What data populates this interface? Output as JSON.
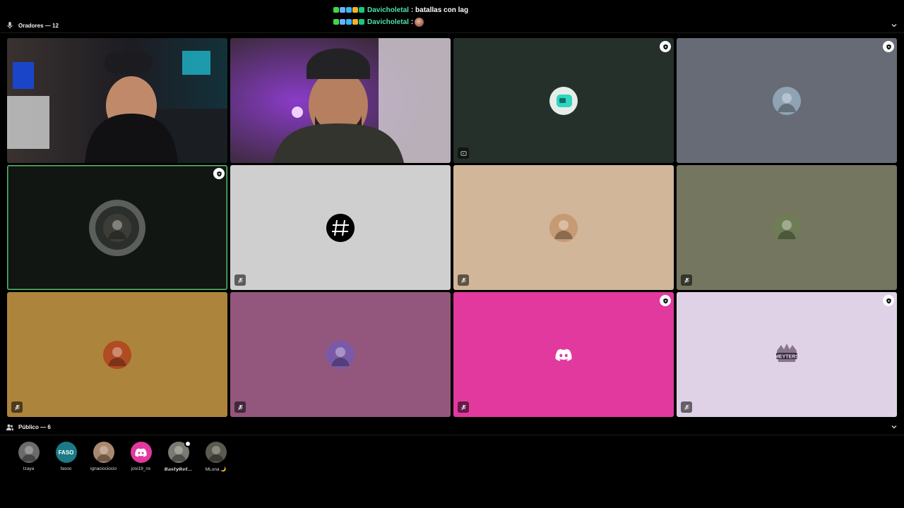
{
  "chat": {
    "messages": [
      {
        "user": "Davicholetal",
        "text": ": batallas con lag",
        "emote": false
      },
      {
        "user": "Davicholetal",
        "text": ":",
        "emote": true
      }
    ],
    "badge_colors": [
      "#3fd94a",
      "#6ab0ff",
      "#37b5ff",
      "#f3b12a",
      "#18c97a"
    ]
  },
  "speakers_section": {
    "label": "Oradores — 12"
  },
  "speakers": [
    {
      "kind": "camera",
      "name": "speaker-camera-1",
      "background": "#2a2520"
    },
    {
      "kind": "camera",
      "name": "speaker-camera-2",
      "background": "#3a2b3e"
    },
    {
      "kind": "avatar",
      "background": "#26302b",
      "avatar": "#2dd6c0",
      "icon": "stream-icon",
      "shield": true
    },
    {
      "kind": "avatar",
      "background": "#676b76",
      "avatar": "#8fa3b4",
      "icon": "",
      "shield": true
    },
    {
      "kind": "avatar",
      "background": "#121612",
      "avatar": "#3d3d38",
      "speaking": true,
      "shield": true
    },
    {
      "kind": "avatar",
      "background": "#cfcfcf",
      "avatar": "#000000",
      "icon": "hashtag-icon",
      "muted": true
    },
    {
      "kind": "avatar",
      "background": "#d1b699",
      "avatar": "#c69a72",
      "muted": true
    },
    {
      "kind": "avatar",
      "background": "#757660",
      "avatar": "#6e7d55",
      "muted": true
    },
    {
      "kind": "avatar",
      "background": "#ad843c",
      "avatar": "#b04b22",
      "muted": true
    },
    {
      "kind": "avatar",
      "background": "#93577e",
      "avatar": "#7a5aa8",
      "muted": true
    },
    {
      "kind": "avatar",
      "background": "#e2399f",
      "avatar": "#e2399f",
      "icon": "discord-icon",
      "shield": true,
      "muted": true
    },
    {
      "kind": "avatar",
      "background": "#e0d2e6",
      "avatar": "#e0d2e6",
      "icon": "meyters-logo",
      "shield": true,
      "muted": true
    }
  ],
  "audience_section": {
    "label": "Público — 6"
  },
  "audience": [
    {
      "name": "Izaya",
      "color": "#6b6b6b"
    },
    {
      "name": "fasoo",
      "color": "#1b7a86",
      "label": "FASO"
    },
    {
      "name": "ignaciociocio",
      "color": "#a9896d"
    },
    {
      "name": "josi19_nx",
      "color": "#e2399f",
      "icon": "discord-icon"
    },
    {
      "name": "𝘽𝙖𝙨𝙩𝙮𝙍𝙚𝙩…",
      "color": "#7a7a72",
      "italic": true,
      "status": true
    },
    {
      "name": "MLuna 🌙",
      "color": "#5a5a50"
    }
  ]
}
